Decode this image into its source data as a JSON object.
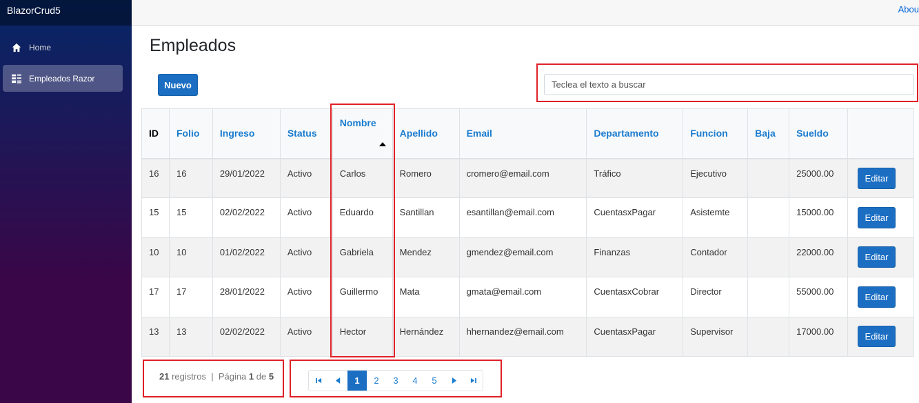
{
  "app": {
    "brand": "BlazorCrud5",
    "about": "Abou"
  },
  "sidebar": {
    "items": [
      {
        "label": "Home",
        "icon": "home-icon"
      },
      {
        "label": "Empleados Razor",
        "icon": "list-icon"
      }
    ]
  },
  "page": {
    "title": "Empleados"
  },
  "toolbar": {
    "new_label": "Nuevo"
  },
  "search": {
    "placeholder": "Teclea el texto a buscar",
    "value": ""
  },
  "table": {
    "headers": [
      "ID",
      "Folio",
      "Ingreso",
      "Status",
      "Nombre",
      "Apellido",
      "Email",
      "Departamento",
      "Funcion",
      "Baja",
      "Sueldo"
    ],
    "sorted_column": "Nombre",
    "sort_direction": "ascending",
    "edit_label": "Editar",
    "rows": [
      [
        "16",
        "16",
        "29/01/2022",
        "Activo",
        "Carlos",
        "Romero",
        "cromero@email.com",
        "Tráfico",
        "Ejecutivo",
        "",
        "25000.00"
      ],
      [
        "15",
        "15",
        "02/02/2022",
        "Activo",
        "Eduardo",
        "Santillan",
        "esantillan@email.com",
        "CuentasxPagar",
        "Asistemte",
        "",
        "15000.00"
      ],
      [
        "10",
        "10",
        "01/02/2022",
        "Activo",
        "Gabriela",
        "Mendez",
        "gmendez@email.com",
        "Finanzas",
        "Contador",
        "",
        "22000.00"
      ],
      [
        "17",
        "17",
        "28/01/2022",
        "Activo",
        "Guillermo",
        "Mata",
        "gmata@email.com",
        "CuentasxCobrar",
        "Director",
        "",
        "55000.00"
      ],
      [
        "13",
        "13",
        "02/02/2022",
        "Activo",
        "Hector",
        "Hernández",
        "hhernandez@email.com",
        "CuentasxPagar",
        "Supervisor",
        "",
        "17000.00"
      ]
    ]
  },
  "footer": {
    "record_count": "21",
    "records_label": "registros",
    "separator": "|",
    "page_label": "Página",
    "current_page": "1",
    "of_label": "de",
    "total_pages": "5"
  },
  "pager": {
    "pages": [
      "1",
      "2",
      "3",
      "4",
      "5"
    ],
    "current": "1"
  },
  "colors": {
    "accent": "#1b6ec2",
    "link": "#1a7ccf",
    "highlight": "#e02027"
  }
}
